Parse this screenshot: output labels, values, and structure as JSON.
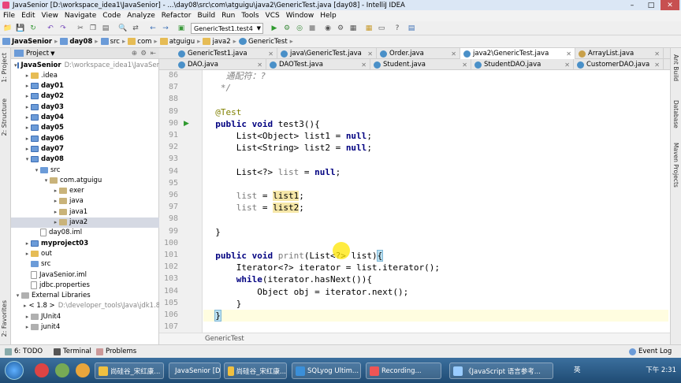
{
  "window": {
    "title": "JavaSenior [D:\\workspace_idea1\\JavaSenior] - ...\\day08\\src\\com\\atguigu\\java2\\GenericTest.java [day08] - IntelliJ IDEA"
  },
  "menu": [
    "File",
    "Edit",
    "View",
    "Navigate",
    "Code",
    "Analyze",
    "Refactor",
    "Build",
    "Run",
    "Tools",
    "VCS",
    "Window",
    "Help"
  ],
  "toolbar": {
    "run_config": "GenericTest1.test4"
  },
  "breadcrumb": [
    "JavaSenior",
    "day08",
    "src",
    "com",
    "atguigu",
    "java2",
    "GenericTest"
  ],
  "project_panel": {
    "header": "Project",
    "tree": [
      {
        "label": "JavaSenior",
        "path": "D:\\workspace_idea1\\JavaSenior",
        "arrow": "▾",
        "icon": "mod",
        "bold": true
      },
      {
        "label": ".idea",
        "arrow": "▸",
        "icon": "yellow"
      },
      {
        "label": "day01",
        "arrow": "▸",
        "icon": "mod",
        "bold": true
      },
      {
        "label": "day02",
        "arrow": "▸",
        "icon": "mod",
        "bold": true
      },
      {
        "label": "day03",
        "arrow": "▸",
        "icon": "mod",
        "bold": true
      },
      {
        "label": "day04",
        "arrow": "▸",
        "icon": "mod",
        "bold": true
      },
      {
        "label": "day05",
        "arrow": "▸",
        "icon": "mod",
        "bold": true
      },
      {
        "label": "day06",
        "arrow": "▸",
        "icon": "mod",
        "bold": true
      },
      {
        "label": "day07",
        "arrow": "▸",
        "icon": "mod",
        "bold": true
      },
      {
        "label": "day08",
        "arrow": "▾",
        "icon": "mod",
        "bold": true
      },
      {
        "label": "src",
        "arrow": "▾",
        "icon": "blue"
      },
      {
        "label": "com.atguigu",
        "arrow": "▾",
        "icon": "pkg"
      },
      {
        "label": "exer",
        "arrow": "▸",
        "icon": "pkg"
      },
      {
        "label": "java",
        "arrow": "▸",
        "icon": "pkg"
      },
      {
        "label": "java1",
        "arrow": "▸",
        "icon": "pkg"
      },
      {
        "label": "java2",
        "arrow": "▸",
        "icon": "pkg",
        "selected": true
      },
      {
        "label": "day08.iml",
        "arrow": "",
        "icon": "file"
      },
      {
        "label": "myproject03",
        "arrow": "▸",
        "icon": "mod",
        "bold": true
      },
      {
        "label": "out",
        "arrow": "▸",
        "icon": "yellow"
      },
      {
        "label": "src",
        "arrow": "",
        "icon": "blue"
      },
      {
        "label": "JavaSenior.iml",
        "arrow": "",
        "icon": "file"
      },
      {
        "label": "jdbc.properties",
        "arrow": "",
        "icon": "file"
      },
      {
        "label": "External Libraries",
        "arrow": "▾",
        "icon": "lib"
      },
      {
        "label": "< 1.8 >",
        "path": "D:\\developer_tools\\Java\\jdk1.8.0",
        "arrow": "▸",
        "icon": "lib"
      },
      {
        "label": "JUnit4",
        "arrow": "▸",
        "icon": "lib"
      },
      {
        "label": "junit4",
        "arrow": "▸",
        "icon": "lib"
      }
    ]
  },
  "left_strip": [
    "1: Project",
    "2: Structure",
    "2: Favorites"
  ],
  "right_strip": [
    "Ant Build",
    "Database",
    "Maven Projects"
  ],
  "editor_tabs_row1": [
    {
      "label": "GenericTest1.java",
      "color": "#4a90c8"
    },
    {
      "label": "java\\GenericTest.java",
      "color": "#4a90c8"
    },
    {
      "label": "Order.java",
      "color": "#4a90c8"
    },
    {
      "label": "java2\\GenericTest.java",
      "color": "#4a90c8",
      "active": true
    },
    {
      "label": "ArrayList.java",
      "color": "#c8a04a"
    }
  ],
  "editor_tabs_row2": [
    {
      "label": "DAO.java",
      "color": "#4a90c8"
    },
    {
      "label": "DAOTest.java",
      "color": "#4a90c8"
    },
    {
      "label": "Student.java",
      "color": "#4a90c8"
    },
    {
      "label": "StudentDAO.java",
      "color": "#4a90c8"
    },
    {
      "label": "CustomerDAO.java",
      "color": "#4a90c8"
    }
  ],
  "code": {
    "line_numbers": [
      "86",
      "87",
      "88",
      "89",
      "90",
      "91",
      "92",
      "93",
      "94",
      "95",
      "96",
      "97",
      "98",
      "99",
      "100",
      "101",
      "102",
      "103",
      "104",
      "105",
      "106",
      "107"
    ],
    "lines": [
      "    通配符：?",
      "   */",
      "",
      "  @Test",
      "  public void test3(){",
      "      List<Object> list1 = null;",
      "      List<String> list2 = null;",
      "",
      "      List<?> list = null;",
      "",
      "      list = list1;",
      "      list = list2;",
      "",
      "  }",
      "",
      "  public void print(List<?> list){",
      "      Iterator<?> iterator = list.iterator();",
      "      while(iterator.hasNext()){",
      "          Object obj = iterator.next();",
      "      }",
      "  }",
      ""
    ]
  },
  "editor_status": "GenericTest",
  "bottom_tools": [
    "6: TODO",
    "Terminal",
    "Problems"
  ],
  "event_log": "Event Log",
  "taskbar": {
    "items": [
      "尚硅谷_宋红康...",
      "JavaSenior [D:...",
      "尚硅谷_宋红康...",
      "SQLyog Ultim...",
      "Recording...",
      "《JavaScript 语言参考..."
    ],
    "tray": "英",
    "clock": "下午 2:31"
  }
}
